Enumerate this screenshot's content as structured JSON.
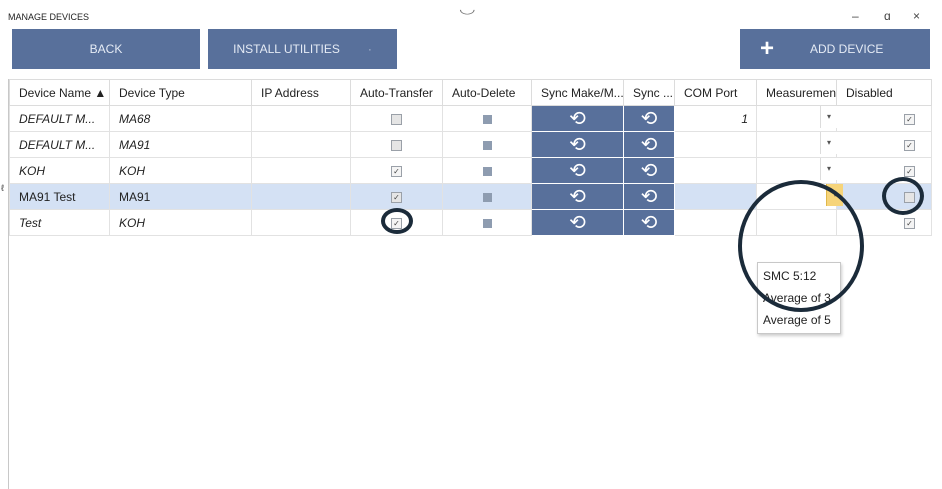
{
  "window": {
    "title": "MANAGE DEVICES",
    "minimize": "–",
    "maximize": "ɑ",
    "close": "×"
  },
  "toolbar": {
    "back_label": "BACK",
    "install_label": "INSTALL UTILITIES",
    "install_arrow": "·",
    "add_plus": "+",
    "add_label": "ADD DEVICE"
  },
  "columns": [
    "Device Name ▲",
    "Device Type",
    "IP Address",
    "Auto-Transfer",
    "Auto-Delete",
    "Sync Make/M...",
    "Sync ...",
    "COM Port",
    "Measuremen...",
    "Disabled"
  ],
  "rows": [
    {
      "name": "DEFAULT M...",
      "type": "MA68",
      "ip": "",
      "auto_transfer": "",
      "auto_delete": "",
      "com": "1",
      "measurement": "",
      "disabled": "✓",
      "sync1": "⟲",
      "sync2": "⟲"
    },
    {
      "name": "DEFAULT M...",
      "type": "MA91",
      "ip": "",
      "auto_transfer": "",
      "auto_delete": "",
      "com": "",
      "measurement": "",
      "disabled": "✓",
      "sync1": "⟲",
      "sync2": "⟲"
    },
    {
      "name": "KOH",
      "type": "KOH",
      "ip": "",
      "auto_transfer": "✓",
      "auto_delete": "",
      "com": "",
      "measurement": "",
      "disabled": "✓",
      "sync1": "⟲",
      "sync2": "⟲"
    },
    {
      "name": "MA91 Test",
      "type": "MA91",
      "ip": "",
      "auto_transfer": "✓",
      "auto_delete": "",
      "com": "",
      "measurement": "",
      "disabled": "",
      "sync1": "⟲",
      "sync2": "⟲"
    },
    {
      "name": "Test",
      "type": "KOH",
      "ip": "",
      "auto_transfer": "✓",
      "auto_delete": "",
      "com": "",
      "measurement": "",
      "disabled": "✓",
      "sync1": "⟲",
      "sync2": "⟲"
    }
  ],
  "row_edit_indicator": "ℓ",
  "dropdown": {
    "options": [
      "SMC 5:12",
      "Average of 3",
      "Average of 5"
    ]
  },
  "colors": {
    "accent": "#58709b",
    "selected_row": "#d4e1f4",
    "highlight_ring": "#1b2b3a"
  }
}
